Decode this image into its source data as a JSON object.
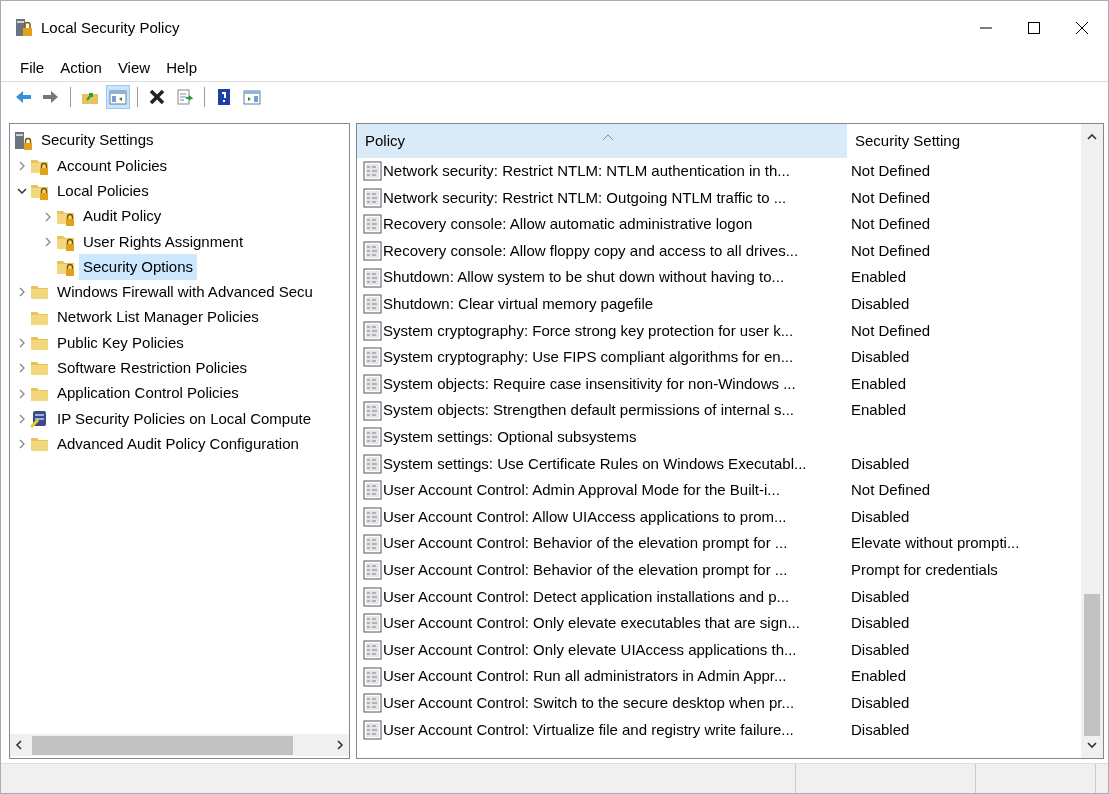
{
  "window": {
    "title": "Local Security Policy"
  },
  "menu": [
    "File",
    "Action",
    "View",
    "Help"
  ],
  "toolbar": [
    {
      "kind": "back",
      "pressed": false
    },
    {
      "kind": "forward",
      "pressed": false
    },
    {
      "kind": "separator"
    },
    {
      "kind": "up",
      "pressed": false
    },
    {
      "kind": "console-tree",
      "pressed": true
    },
    {
      "kind": "separator"
    },
    {
      "kind": "delete",
      "pressed": false
    },
    {
      "kind": "export",
      "pressed": false
    },
    {
      "kind": "separator"
    },
    {
      "kind": "help",
      "pressed": false
    },
    {
      "kind": "action-pane",
      "pressed": false
    }
  ],
  "tree": [
    {
      "label": "Security Settings",
      "kind": "root",
      "selected": false,
      "children": [
        {
          "label": "Account Policies",
          "kind": "locked-folder",
          "expanded": false,
          "selected": false
        },
        {
          "label": "Local Policies",
          "kind": "locked-folder",
          "expanded": true,
          "selected": false,
          "children": [
            {
              "label": "Audit Policy",
              "kind": "locked-folder",
              "expanded": false,
              "selected": false
            },
            {
              "label": "User Rights Assignment",
              "kind": "locked-folder",
              "expanded": false,
              "selected": false
            },
            {
              "label": "Security Options",
              "kind": "locked-folder",
              "selected": true
            }
          ]
        },
        {
          "label": "Windows Firewall with Advanced Secu",
          "kind": "folder",
          "expanded": false,
          "selected": false
        },
        {
          "label": "Network List Manager Policies",
          "kind": "folder",
          "selected": false
        },
        {
          "label": "Public Key Policies",
          "kind": "folder",
          "expanded": false,
          "selected": false
        },
        {
          "label": "Software Restriction Policies",
          "kind": "folder",
          "expanded": false,
          "selected": false
        },
        {
          "label": "Application Control Policies",
          "kind": "folder",
          "expanded": false,
          "selected": false
        },
        {
          "label": "IP Security Policies on Local Compute",
          "kind": "computer-policy",
          "expanded": false,
          "selected": false
        },
        {
          "label": "Advanced Audit Policy Configuration",
          "kind": "folder",
          "expanded": false,
          "selected": false
        }
      ]
    }
  ],
  "table": {
    "columns": [
      {
        "label": "Policy",
        "sorted": true
      },
      {
        "label": "Security Setting",
        "sorted": false
      }
    ],
    "rows": [
      {
        "policy": "Network security: Restrict NTLM: NTLM authentication in th...",
        "setting": "Not Defined"
      },
      {
        "policy": "Network security: Restrict NTLM: Outgoing NTLM traffic to ...",
        "setting": "Not Defined"
      },
      {
        "policy": "Recovery console: Allow automatic administrative logon",
        "setting": "Not Defined"
      },
      {
        "policy": "Recovery console: Allow floppy copy and access to all drives...",
        "setting": "Not Defined"
      },
      {
        "policy": "Shutdown: Allow system to be shut down without having to...",
        "setting": "Enabled"
      },
      {
        "policy": "Shutdown: Clear virtual memory pagefile",
        "setting": "Disabled"
      },
      {
        "policy": "System cryptography: Force strong key protection for user k...",
        "setting": "Not Defined"
      },
      {
        "policy": "System cryptography: Use FIPS compliant algorithms for en...",
        "setting": "Disabled"
      },
      {
        "policy": "System objects: Require case insensitivity for non-Windows ...",
        "setting": "Enabled"
      },
      {
        "policy": "System objects: Strengthen default permissions of internal s...",
        "setting": "Enabled"
      },
      {
        "policy": "System settings: Optional subsystems"
      },
      {
        "policy": "System settings: Use Certificate Rules on Windows Executabl...",
        "setting": "Disabled"
      },
      {
        "policy": "User Account Control: Admin Approval Mode for the Built-i...",
        "setting": "Not Defined"
      },
      {
        "policy": "User Account Control: Allow UIAccess applications to prom...",
        "setting": "Disabled"
      },
      {
        "policy": "User Account Control: Behavior of the elevation prompt for ...",
        "setting": "Elevate without prompti..."
      },
      {
        "policy": "User Account Control: Behavior of the elevation prompt for ...",
        "setting": "Prompt for credentials"
      },
      {
        "policy": "User Account Control: Detect application installations and p...",
        "setting": "Disabled"
      },
      {
        "policy": "User Account Control: Only elevate executables that are sign...",
        "setting": "Disabled"
      },
      {
        "policy": "User Account Control: Only elevate UIAccess applications th...",
        "setting": "Disabled"
      },
      {
        "policy": "User Account Control: Run all administrators in Admin Appr...",
        "setting": "Enabled"
      },
      {
        "policy": "User Account Control: Switch to the secure desktop when pr...",
        "setting": "Disabled"
      },
      {
        "policy": "User Account Control: Virtualize file and registry write failure...",
        "setting": "Disabled"
      }
    ]
  }
}
